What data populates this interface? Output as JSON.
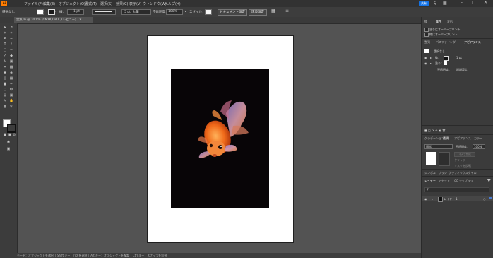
{
  "menubar": {
    "app_icon": "Ai",
    "items": [
      "ファイル(F)",
      "編集(E)",
      "オブジェクト(O)",
      "書式(T)",
      "選択(S)",
      "効果(C)",
      "表示(V)",
      "ウィンドウ(W)",
      "ヘルプ(H)"
    ],
    "share_label": "共有"
  },
  "control": {
    "selection_label": "選択なし",
    "stroke_weight": "1 pt",
    "brush_label": "基本",
    "profile_label": "5 pt. 丸筆",
    "opacity_label": "不透明度：",
    "opacity_value": "100%",
    "style_label": "スタイル：",
    "doc_setup_button": "ドキュメント設定",
    "preferences_button": "環境設定"
  },
  "document_tab": {
    "title": "金魚.ai @ 100 % (CMYK/GPU プレビュー)"
  },
  "status": {
    "text": "モード：オブジェクトを選択 │ Shift キー：パスを連結 │ Alt キー：オブジェクトを複製 │ Ctrl キー：スナップを切替"
  },
  "attributes_panel": {
    "tabs": [
      "線",
      "属性",
      "変形"
    ],
    "overprint_fill": "塗りにオーバープリント",
    "overprint_stroke": "線にオーバープリント"
  },
  "appearance_panel": {
    "tabs": [
      "整列",
      "パスファインダー",
      "アピアランス"
    ],
    "title": "選択なし",
    "stroke_label": "線：",
    "stroke_value": "1 pt",
    "fill_label": "塗り：",
    "opacity_label": "不透明度：",
    "opacity_value": "初期設定"
  },
  "transparency_panel": {
    "tabs": [
      "グラデーション",
      "透明",
      "アピアランス",
      "カラー"
    ],
    "blend_mode": "通常",
    "opacity_label": "不透明度：",
    "opacity_value": "100%",
    "options": [
      "マスク作成",
      "クリップ",
      "マスクを反転"
    ]
  },
  "layers_panel": {
    "top_tabs": [
      "シンボル",
      "ブラシ",
      "グラフィックスタイル"
    ],
    "tabs": [
      "レイヤー",
      "アセット",
      "CC ライブラリ"
    ],
    "search_placeholder": "",
    "layer_name": "レイヤー 1"
  },
  "colors": {
    "menubar": "#323232",
    "workspace": "#535353",
    "panel": "#3b3b3b",
    "share_button": "#1473e6",
    "layer_color": "#4a7bd0"
  }
}
